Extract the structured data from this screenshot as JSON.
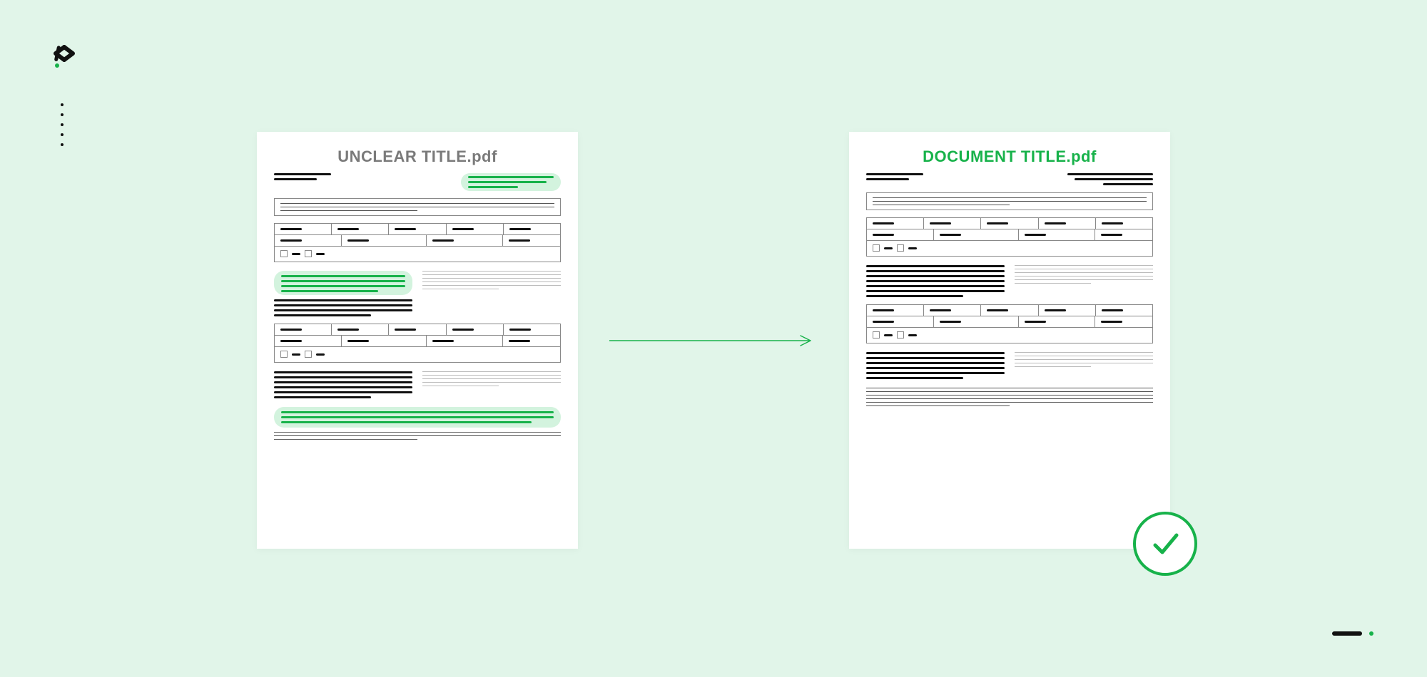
{
  "colors": {
    "bg": "#e1f5e9",
    "accent": "#17b24a",
    "text_muted": "#7a7a7a",
    "ink": "#111111"
  },
  "left_doc": {
    "title": "UNCLEAR TITLE.pdf",
    "highlighted": true
  },
  "right_doc": {
    "title": "DOCUMENT TITLE.pdf",
    "highlighted": false
  }
}
